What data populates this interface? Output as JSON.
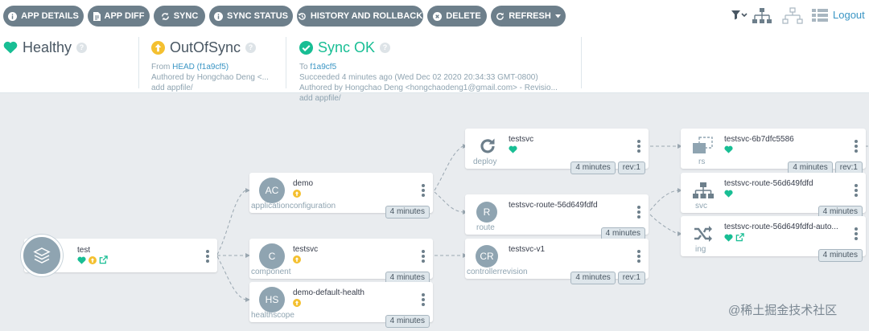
{
  "toolbar": {
    "buttons": [
      {
        "label": "APP DETAILS",
        "icon": "info-icon"
      },
      {
        "label": "APP DIFF",
        "icon": "file-icon"
      },
      {
        "label": "SYNC",
        "icon": "sync-icon"
      },
      {
        "label": "SYNC STATUS",
        "icon": "info-icon"
      },
      {
        "label": "HISTORY AND ROLLBACK",
        "icon": "history-icon"
      },
      {
        "label": "DELETE",
        "icon": "close-circle-icon"
      },
      {
        "label": "REFRESH",
        "icon": "refresh-icon"
      }
    ],
    "logout": "Logout"
  },
  "status": {
    "health": {
      "title": "Healthy",
      "help": "?"
    },
    "sync": {
      "title": "OutOfSync",
      "help": "?",
      "from_prefix": "From ",
      "from_ref": "HEAD (f1a9cf5)",
      "author": "Authored by Hongchao Deng <...",
      "message": "add appfile/"
    },
    "op": {
      "title": "Sync OK",
      "help": "?",
      "to_prefix": "To ",
      "to_ref": "f1a9cf5",
      "time": "Succeeded 4 minutes ago (Wed Dec 02 2020 20:34:33 GMT-0800)",
      "author": "Authored by Hongchao Deng <hongchaodeng1@gmail.com> - Revisio...",
      "message": "add appfile/"
    }
  },
  "colors": {
    "healthy": "#18be94",
    "outofsync": "#f4c030",
    "button": "#6d7f8b",
    "link": "#3a95c4"
  },
  "graph": {
    "app": {
      "name": "test"
    },
    "nodes": [
      {
        "id": "demo",
        "abbr": "AC",
        "name": "demo",
        "kind": "applicationconfiguration",
        "age": "4 minutes",
        "rev": ""
      },
      {
        "id": "testsvc-c",
        "abbr": "C",
        "name": "testsvc",
        "kind": "component",
        "age": "4 minutes",
        "rev": ""
      },
      {
        "id": "health",
        "abbr": "HS",
        "name": "demo-default-health",
        "kind": "healthscope",
        "age": "4 minutes",
        "rev": ""
      },
      {
        "id": "deploy",
        "abbr": "",
        "name": "testsvc",
        "kind": "deploy",
        "age": "4 minutes",
        "rev": "rev:1"
      },
      {
        "id": "route",
        "abbr": "R",
        "name": "testsvc-route-56d649fdfd",
        "kind": "route",
        "age": "4 minutes",
        "rev": ""
      },
      {
        "id": "cr",
        "abbr": "CR",
        "name": "testsvc-v1",
        "kind": "controllerrevision",
        "age": "4 minutes",
        "rev": "rev:1"
      },
      {
        "id": "rs",
        "abbr": "",
        "name": "testsvc-6b7dfc5586",
        "kind": "rs",
        "age": "4 minutes",
        "rev": "rev:1"
      },
      {
        "id": "svc",
        "abbr": "",
        "name": "testsvc-route-56d649fdfd",
        "kind": "svc",
        "age": "4 minutes",
        "rev": ""
      },
      {
        "id": "ing",
        "abbr": "",
        "name": "testsvc-route-56d649fdfd-auto...",
        "kind": "ing",
        "age": "4 minutes",
        "rev": ""
      }
    ]
  },
  "watermark": "@稀土掘金技术社区"
}
